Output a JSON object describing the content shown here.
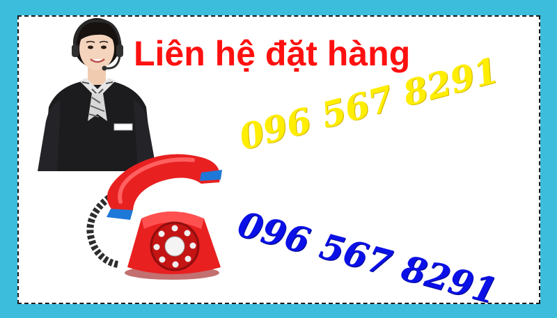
{
  "banner": {
    "title": "Liên hệ đặt hàng",
    "phone_primary": "096 567 8291",
    "phone_secondary": "096 567 8291"
  },
  "images": {
    "agent": "customer-service-agent-with-headset",
    "telephone": "red-rotary-telephone"
  },
  "colors": {
    "frame": "#3cbddc",
    "card": "#ffffff",
    "title": "#ff1010",
    "phone_primary": "#ffee00",
    "phone_secondary": "#0a10e6",
    "telephone_body": "#e82020"
  }
}
